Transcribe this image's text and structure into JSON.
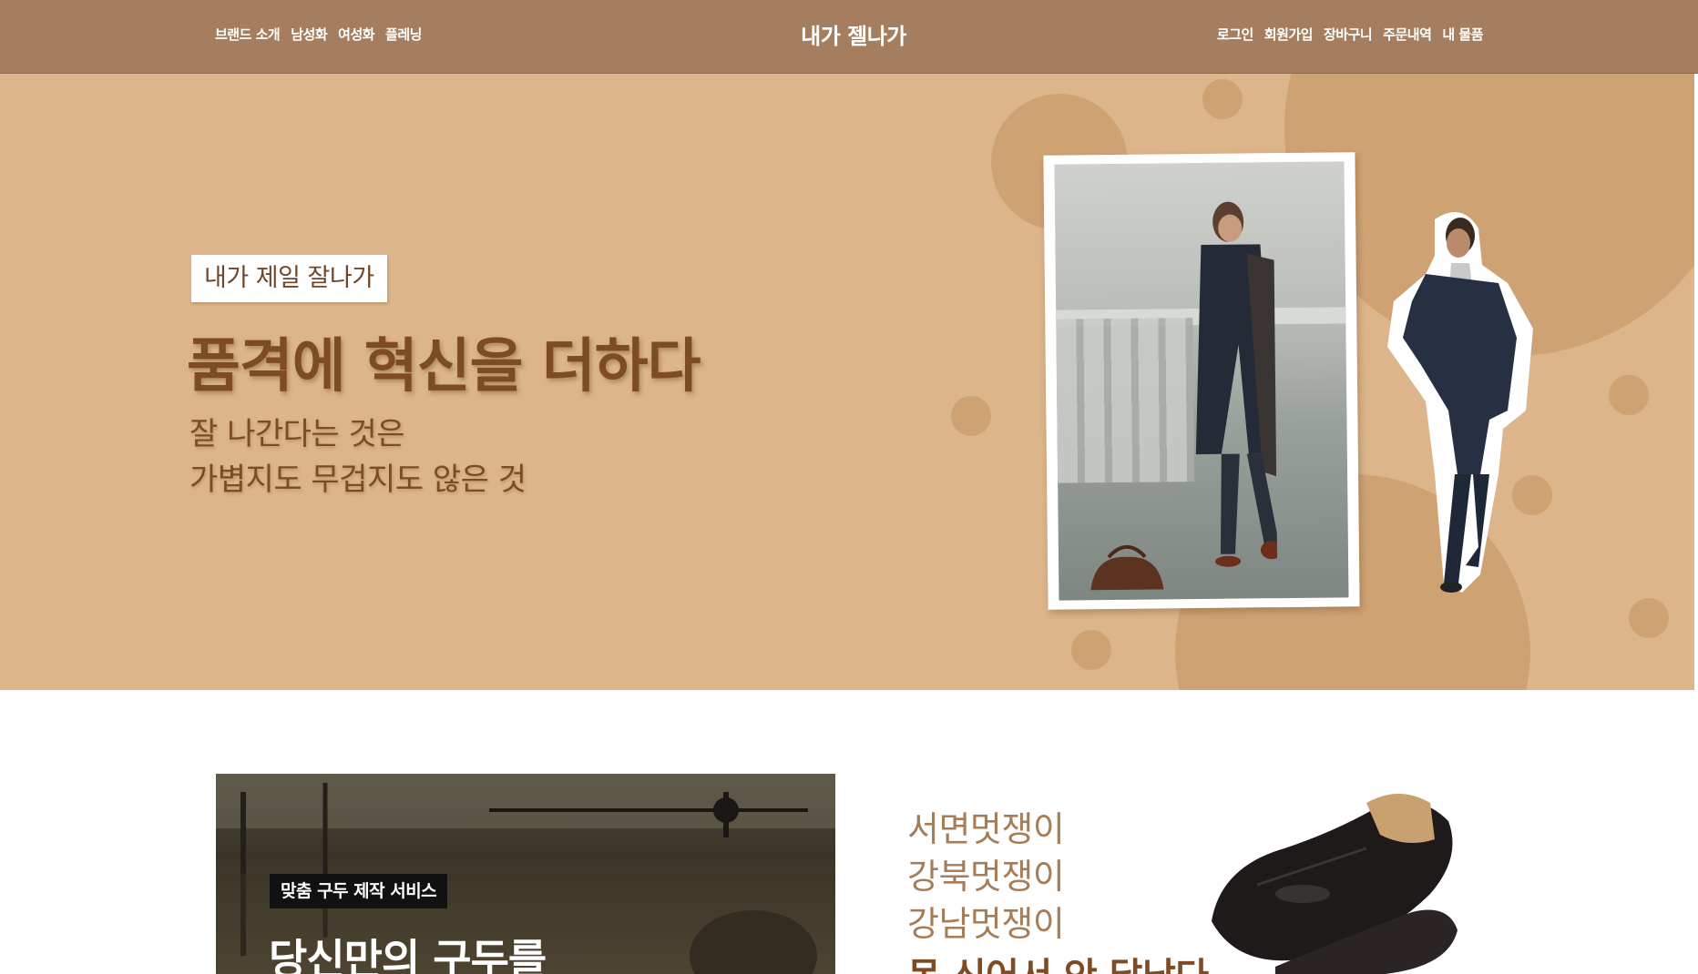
{
  "header": {
    "brand": "내가 젤나가",
    "nav_left": [
      "브랜드 소개",
      "남성화",
      "여성화",
      "플레닝"
    ],
    "nav_right": [
      "로그인",
      "회원가입",
      "장바구니",
      "주문내역",
      "내 물품"
    ],
    "bg_color": "#a47e5e"
  },
  "hero": {
    "tagline": "내가 제일 잘나가",
    "headline": "품격에 혁신을 더하다",
    "subline_1": "잘 나간다는 것은",
    "subline_2": "가볍지도 무겁지도 않은 것",
    "bg_color": "#dcb58a",
    "accent_color": "#7d4c24"
  },
  "promo": {
    "banner_tag": "맞춤 구두 제작 서비스",
    "banner_title": "당신만의 구두를",
    "line_1": "서면멋쟁이",
    "line_2": "강북멋쟁이",
    "line_3": "강남멋쟁이",
    "line_bold": "못 신어서 안 달났다"
  }
}
